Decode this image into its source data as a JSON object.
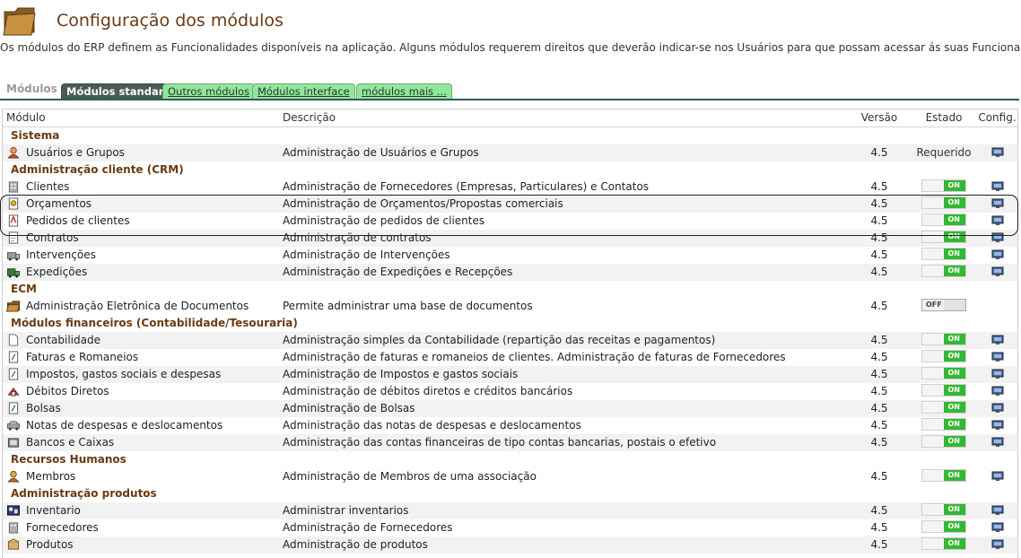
{
  "header": {
    "title": "Configuração dos módulos",
    "intro": "Os módulos do ERP definem as Funcionalidades disponíveis na aplicação. Alguns módulos requerem direitos que deverão indicar-se nos Usuários para que possam acessar ás suas Funcionalidades."
  },
  "tabs": {
    "label": "Módulos",
    "items": [
      "Módulos standard",
      "Outros módulos",
      "Módulos interface",
      "módulos mais ..."
    ],
    "active_index": 0
  },
  "table": {
    "columns": {
      "module": "Módulo",
      "description": "Descrição",
      "version": "Versão",
      "state": "Estado",
      "config": "Config."
    }
  },
  "switch": {
    "on": "ON",
    "off": "OFF"
  },
  "rows": [
    {
      "type": "group",
      "label": "Sistema"
    },
    {
      "type": "module",
      "icon": "user-icon",
      "name": "Usuários e Grupos",
      "desc": "Administração de Usuários e Grupos",
      "version": "4.5",
      "state": "Requerido",
      "config": true
    },
    {
      "type": "group",
      "label": "Administração cliente (CRM)"
    },
    {
      "type": "module",
      "icon": "company-icon",
      "name": "Clientes",
      "desc": "Administração de Fornecedores (Empresas, Particulares) e Contatos",
      "version": "4.5",
      "state": "on",
      "config": true
    },
    {
      "type": "module",
      "icon": "proposal-icon",
      "name": "Orçamentos",
      "desc": "Administração de Orçamentos/Propostas comerciais",
      "version": "4.5",
      "state": "on",
      "config": true
    },
    {
      "type": "module",
      "icon": "order-icon",
      "name": "Pedidos de clientes",
      "desc": "Administração de pedidos de clientes",
      "version": "4.5",
      "state": "on",
      "config": true
    },
    {
      "type": "module",
      "icon": "contract-icon",
      "name": "Contratos",
      "desc": "Administração de contratos",
      "version": "4.5",
      "state": "on",
      "config": true
    },
    {
      "type": "module",
      "icon": "intervention-icon",
      "name": "Intervenções",
      "desc": "Administração de Intervenções",
      "version": "4.5",
      "state": "on",
      "config": true
    },
    {
      "type": "module",
      "icon": "truck-icon",
      "name": "Expedições",
      "desc": "Administração de Expedições e Recepções",
      "version": "4.5",
      "state": "on",
      "config": true
    },
    {
      "type": "group",
      "label": "ECM"
    },
    {
      "type": "module",
      "icon": "folder-icon",
      "name": "Administração Eletrônica de Documentos",
      "desc": "Permite administrar uma base de documentos",
      "version": "4.5",
      "state": "off",
      "config": false
    },
    {
      "type": "group",
      "label": "Módulos financeiros (Contabilidade/Tesouraria)"
    },
    {
      "type": "module",
      "icon": "document-icon",
      "name": "Contabilidade",
      "desc": "Administração simples da Contabilidade (repartição das receitas e pagamentos)",
      "version": "4.5",
      "state": "on",
      "config": true
    },
    {
      "type": "module",
      "icon": "invoice-icon",
      "name": "Faturas e Romaneios",
      "desc": "Administração de faturas e romaneios de clientes. Administração de faturas de Fornecedores",
      "version": "4.5",
      "state": "on",
      "config": true
    },
    {
      "type": "module",
      "icon": "tax-icon",
      "name": "Impostos, gastos sociais e despesas",
      "desc": "Administração de Impostos e gastos sociais",
      "version": "4.5",
      "state": "on",
      "config": true
    },
    {
      "type": "module",
      "icon": "debit-icon",
      "name": "Débitos Diretos",
      "desc": "Administração de débitos diretos e créditos bancários",
      "version": "4.5",
      "state": "on",
      "config": true
    },
    {
      "type": "module",
      "icon": "grant-icon",
      "name": "Bolsas",
      "desc": "Administração de Bolsas",
      "version": "4.5",
      "state": "on",
      "config": true
    },
    {
      "type": "module",
      "icon": "car-icon",
      "name": "Notas de despesas e deslocamentos",
      "desc": "Administração das notas de despesas e deslocamentos",
      "version": "4.5",
      "state": "on",
      "config": true
    },
    {
      "type": "module",
      "icon": "bank-icon",
      "name": "Bancos e Caixas",
      "desc": "Administração das contas financeiras de tipo contas bancarias, postais o efetivo",
      "version": "4.5",
      "state": "on",
      "config": true
    },
    {
      "type": "group",
      "label": "Recursos Humanos"
    },
    {
      "type": "module",
      "icon": "member-icon",
      "name": "Membros",
      "desc": "Administração de Membros de uma associação",
      "version": "4.5",
      "state": "on",
      "config": true
    },
    {
      "type": "group",
      "label": "Administração produtos"
    },
    {
      "type": "module",
      "icon": "inventory-icon",
      "name": "Inventario",
      "desc": "Administrar inventarios",
      "version": "4.5",
      "state": "on",
      "config": true
    },
    {
      "type": "module",
      "icon": "supplier-icon",
      "name": "Fornecedores",
      "desc": "Administração de Fornecedores",
      "version": "4.5",
      "state": "on",
      "config": true
    },
    {
      "type": "module",
      "icon": "product-icon",
      "name": "Produtos",
      "desc": "Administração de produtos",
      "version": "4.5",
      "state": "on",
      "config": true
    }
  ],
  "colors": {
    "title": "#6b3a12",
    "switch_on": "#33b833",
    "tab_active": "#4a5a56",
    "tab_inactive": "#8fe89a",
    "row_alt": "#f2f2f2"
  }
}
